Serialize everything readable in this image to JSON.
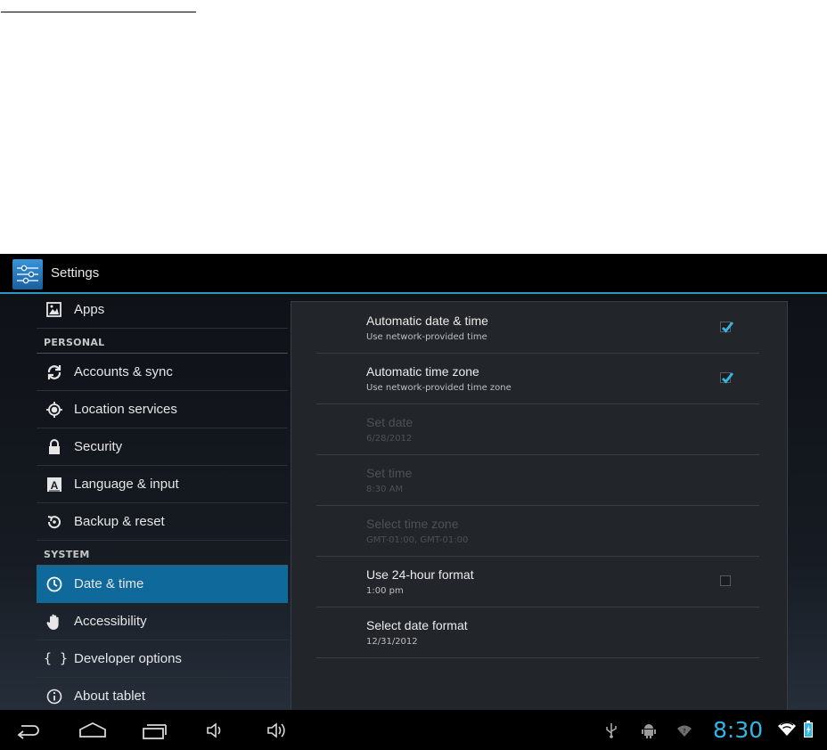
{
  "app": {
    "title": "Settings"
  },
  "sidebar": {
    "apps_label": "Apps",
    "personal_header": "PERSONAL",
    "personal_items": [
      {
        "label": "Accounts & sync",
        "icon": "sync-icon"
      },
      {
        "label": "Location services",
        "icon": "location-icon"
      },
      {
        "label": "Security",
        "icon": "lock-icon"
      },
      {
        "label": "Language & input",
        "icon": "keyboard-a-icon"
      },
      {
        "label": "Backup & reset",
        "icon": "backup-icon"
      }
    ],
    "system_header": "SYSTEM",
    "system_items": [
      {
        "label": "Date & time",
        "icon": "clock-icon",
        "selected": true
      },
      {
        "label": "Accessibility",
        "icon": "hand-icon"
      },
      {
        "label": "Developer options",
        "icon": "braces-icon"
      },
      {
        "label": "About tablet",
        "icon": "info-icon"
      }
    ],
    "developer_glyph": "{ }"
  },
  "prefs": [
    {
      "title": "Automatic date & time",
      "summary": "Use network-provided time",
      "checked": true
    },
    {
      "title": "Automatic time zone",
      "summary": "Use network-provided time zone",
      "checked": true
    },
    {
      "title": "Set date",
      "summary": "6/28/2012",
      "disabled": true
    },
    {
      "title": "Set time",
      "summary": "8:30 AM",
      "disabled": true
    },
    {
      "title": "Select time zone",
      "summary": "GMT-01:00, GMT-01:00",
      "disabled": true
    },
    {
      "title": "Use 24-hour format",
      "summary": "1:00 pm",
      "checked": false
    },
    {
      "title": "Select date format",
      "summary": "12/31/2012"
    }
  ],
  "statusbar": {
    "time": "8:30"
  },
  "colors": {
    "accent": "#33b5e5",
    "selected_bg": "#0f6a9b",
    "action_underline": "#2f95c6"
  }
}
